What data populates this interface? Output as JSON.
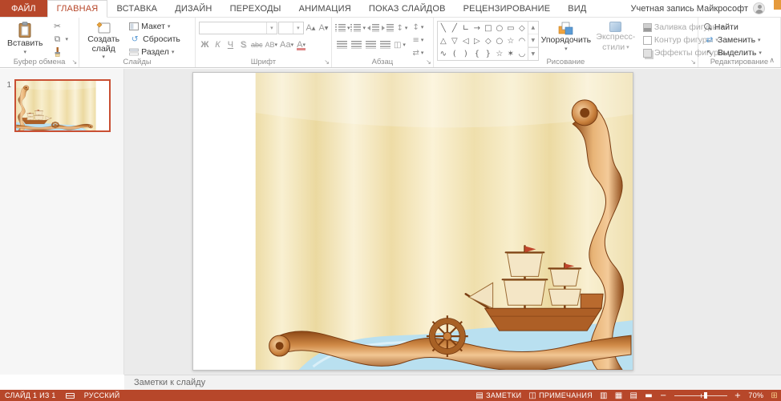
{
  "titlebar": {
    "account_label": "Учетная запись Майкрософт"
  },
  "tabs": {
    "file": "ФАЙЛ",
    "items": [
      "ГЛАВНАЯ",
      "ВСТАВКА",
      "ДИЗАЙН",
      "ПЕРЕХОДЫ",
      "АНИМАЦИЯ",
      "ПОКАЗ СЛАЙДОВ",
      "РЕЦЕНЗИРОВАНИЕ",
      "ВИД"
    ]
  },
  "ribbon": {
    "groups": {
      "clipboard": "Буфер обмена",
      "slides": "Слайды",
      "font": "Шрифт",
      "paragraph": "Абзац",
      "drawing": "Рисование",
      "editing": "Редактирование"
    },
    "clipboard": {
      "paste": "Вставить"
    },
    "slides": {
      "new_slide": "Создать слайд",
      "layout": "Макет",
      "reset": "Сбросить",
      "section": "Раздел"
    },
    "font": {
      "bold": "Ж",
      "italic": "К",
      "underline": "Ч",
      "shadow": "S",
      "strike": "abc",
      "spacing": "АВ",
      "case": "Аа",
      "color": "А",
      "grow": "А",
      "shrink": "А"
    },
    "drawing": {
      "arrange": "Упорядочить",
      "quick_styles_line1": "Экспресс-",
      "quick_styles_line2": "стили",
      "fill": "Заливка фигуры",
      "outline": "Контур фигуры",
      "effects": "Эффекты фигуры",
      "shape_rows": [
        [
          "╲",
          "╱",
          "∟",
          "→",
          "□",
          "○",
          "▭",
          "◇"
        ],
        [
          "△",
          "▽",
          "◁",
          "▷",
          "◇",
          "○",
          "☆",
          "◠"
        ],
        [
          "∿",
          "(",
          ")",
          "{",
          "}",
          "☆",
          "✶",
          "◡"
        ]
      ]
    },
    "editing": {
      "find": "Найти",
      "replace": "Заменить",
      "select": "Выделить"
    }
  },
  "sidebar": {
    "slide_number": "1"
  },
  "notes": {
    "label": "Заметки к слайду"
  },
  "statusbar": {
    "slide_info": "СЛАЙД 1 ИЗ 1",
    "language": "РУССКИЙ",
    "notes": "ЗАМЕТКИ",
    "comments": "ПРИМЕЧАНИЯ",
    "zoom_level": "70%"
  },
  "icons": {
    "caret": "▾",
    "collapse_ribbon": "∧",
    "scissors": "✂",
    "copy": "⧉",
    "reset": "↺",
    "grow": "▲",
    "shrink": "▼",
    "updown": "↕",
    "lines": "≡",
    "swap": "⇄",
    "select_cursor": "↖",
    "columns": "◫",
    "gallery_up": "▲",
    "gallery_down": "▼",
    "gallery_more": "▼",
    "note": "▤",
    "comment": "◫",
    "views": [
      "▥",
      "▦",
      "▤",
      "▬"
    ],
    "minus": "−",
    "plus": "+",
    "fit": "⊞"
  },
  "colors": {
    "accent": "#B7472A",
    "selection_border": "#C94F33"
  }
}
